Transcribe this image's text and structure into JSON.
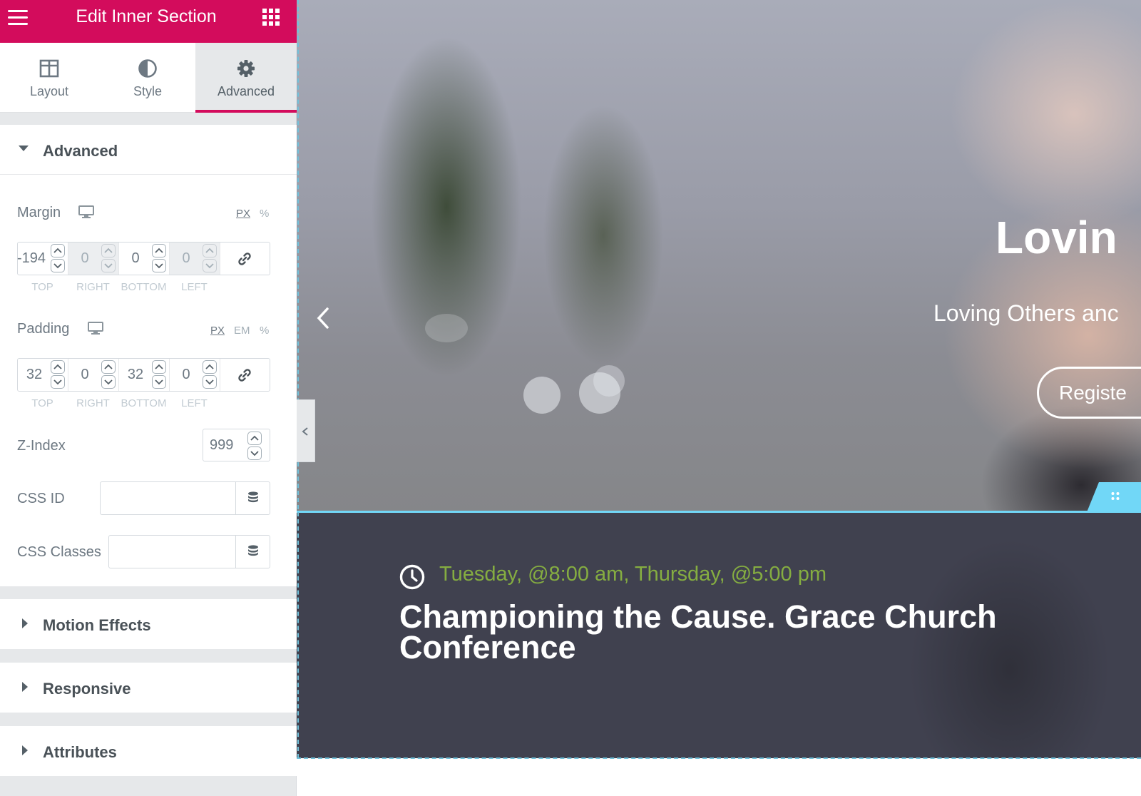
{
  "panel": {
    "title": "Edit Inner Section",
    "tabs": [
      {
        "label": "Layout",
        "icon": "columns-icon"
      },
      {
        "label": "Style",
        "icon": "half-circle-icon"
      },
      {
        "label": "Advanced",
        "icon": "gear-icon",
        "active": true
      }
    ],
    "advanced_section": {
      "title": "Advanced",
      "margin": {
        "label": "Margin",
        "units": [
          "PX",
          "%"
        ],
        "active_unit": "PX",
        "values": {
          "top": "-194",
          "right": "0",
          "bottom": "0",
          "left": "0"
        },
        "labels": {
          "top": "TOP",
          "right": "RIGHT",
          "bottom": "BOTTOM",
          "left": "LEFT"
        }
      },
      "padding": {
        "label": "Padding",
        "units": [
          "PX",
          "EM",
          "%"
        ],
        "active_unit": "PX",
        "values": {
          "top": "32",
          "right": "0",
          "bottom": "32",
          "left": "0"
        },
        "labels": {
          "top": "TOP",
          "right": "RIGHT",
          "bottom": "BOTTOM",
          "left": "LEFT"
        }
      },
      "z_index": {
        "label": "Z-Index",
        "value": "999"
      },
      "css_id": {
        "label": "CSS ID",
        "value": ""
      },
      "css_classes": {
        "label": "CSS Classes",
        "value": ""
      }
    },
    "collapsed_sections": [
      "Motion Effects",
      "Responsive",
      "Attributes"
    ]
  },
  "canvas": {
    "hero": {
      "headline": "Lovin",
      "subheading": "Loving Others anc",
      "button": "Registe"
    },
    "event": {
      "date": "Tuesday, @8:00 am, Thursday, @5:00 pm",
      "title": "Championing the Cause. Grace Church Conference"
    }
  },
  "colors": {
    "brand": "#d30c5c",
    "selection": "#71d7f7",
    "event_date": "#85ad41",
    "inner_bg": "#40414f"
  }
}
